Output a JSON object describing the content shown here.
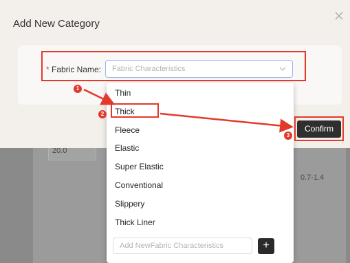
{
  "background": {
    "cell_value": "20.0",
    "side_value": "0.7-1.4"
  },
  "modal": {
    "title": "Add New Category",
    "close_icon": "close-icon",
    "field": {
      "required_marker": "*",
      "label": "Fabric Name:",
      "placeholder": "Fabric Characteristics",
      "chevron_icon": "chevron-down-icon"
    },
    "confirm_label": "Confirm"
  },
  "dropdown": {
    "options": [
      "Thin",
      "Thick",
      "Fleece",
      "Elastic",
      "Super Elastic",
      "Conventional",
      "Slippery",
      "Thick Liner"
    ],
    "add_placeholder": "Add NewFabric Characteristics",
    "add_button_label": "+"
  },
  "annotations": {
    "steps": [
      "1",
      "2",
      "3"
    ],
    "color": "#e23a2a"
  },
  "colors": {
    "confirm_bg": "#2f2f2f",
    "required": "#e04040",
    "input_border_focus": "#9bb7ea"
  }
}
